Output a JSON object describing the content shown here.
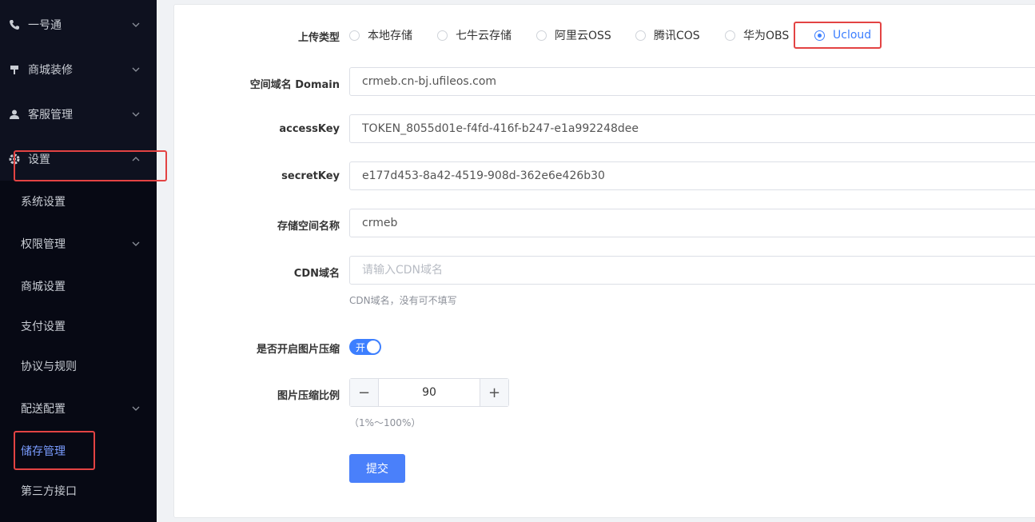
{
  "sidebar": {
    "top_items": [
      {
        "label": "一号通",
        "icon": "phone-icon"
      },
      {
        "label": "商城装修",
        "icon": "brush-icon"
      },
      {
        "label": "客服管理",
        "icon": "user-icon"
      },
      {
        "label": "设置",
        "icon": "gear-icon"
      }
    ],
    "sub_items": [
      {
        "label": "系统设置"
      },
      {
        "label": "权限管理"
      },
      {
        "label": "商城设置"
      },
      {
        "label": "支付设置"
      },
      {
        "label": "协议与规则"
      },
      {
        "label": "配送配置"
      },
      {
        "label": "储存管理"
      },
      {
        "label": "第三方接口"
      }
    ]
  },
  "form": {
    "upload_type_label": "上传类型",
    "upload_options": [
      "本地存储",
      "七牛云存储",
      "阿里云OSS",
      "腾讯COS",
      "华为OBS",
      "Ucloud"
    ],
    "upload_selected": "Ucloud",
    "domain_label": "空间域名 Domain",
    "domain_value": "crmeb.cn-bj.ufileos.com",
    "access_key_label": "accessKey",
    "access_key_value": "TOKEN_8055d01e-f4fd-416f-b247-e1a992248dee",
    "secret_key_label": "secretKey",
    "secret_key_value": "e177d453-8a42-4519-908d-362e6e426b30",
    "bucket_label": "存储空间名称",
    "bucket_value": "crmeb",
    "cdn_label": "CDN域名",
    "cdn_placeholder": "请输入CDN域名",
    "cdn_hint": "CDN域名，没有可不填写",
    "compress_label": "是否开启图片压缩",
    "compress_switch_text": "开",
    "compress_enabled": true,
    "ratio_label": "图片压缩比例",
    "ratio_value": "90",
    "ratio_hint": "（1%～100%）",
    "submit_label": "提交"
  },
  "colors": {
    "accent": "#3d7fff",
    "highlight": "#e34343",
    "sidebar_bg": "#0e111f"
  }
}
